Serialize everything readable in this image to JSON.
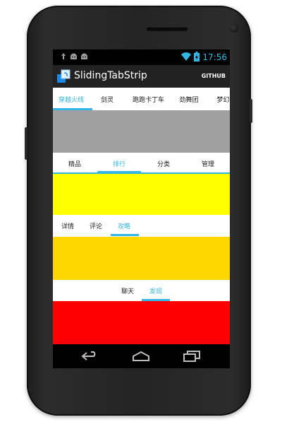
{
  "status_bar": {
    "notification_icons": [
      "usb-debugging-icon",
      "android-icon",
      "android-icon"
    ],
    "system_icons": [
      "wifi-icon",
      "battery-charging-icon"
    ],
    "time": "17:56"
  },
  "action_bar": {
    "app_icon": "app-logo-icon",
    "title": "SlidingTabStrip",
    "action_label": "GITHUB"
  },
  "strip1": {
    "tabs": [
      "穿越火线",
      "剑灵",
      "跑跑卡丁车",
      "劲舞团",
      "梦幻西"
    ],
    "active_index": 0
  },
  "block1": {
    "color": "#a0a0a0"
  },
  "strip2": {
    "tabs": [
      "精品",
      "排行",
      "分类",
      "管理"
    ],
    "active_index": 1
  },
  "block2": {
    "color": "#ffff00"
  },
  "strip3": {
    "tabs": [
      "详情",
      "评论",
      "攻略"
    ],
    "active_index": 2
  },
  "block3": {
    "color": "#ffd700"
  },
  "strip4": {
    "tabs": [
      "聊天",
      "发现"
    ],
    "active_index": 1
  },
  "block4": {
    "color": "#ff0000"
  },
  "nav_bar": {
    "buttons": [
      "back-icon",
      "home-icon",
      "recent-apps-icon"
    ]
  },
  "colors": {
    "accent": "#33b5e5",
    "action_bar": "#222222",
    "tab_text": "#222222"
  }
}
